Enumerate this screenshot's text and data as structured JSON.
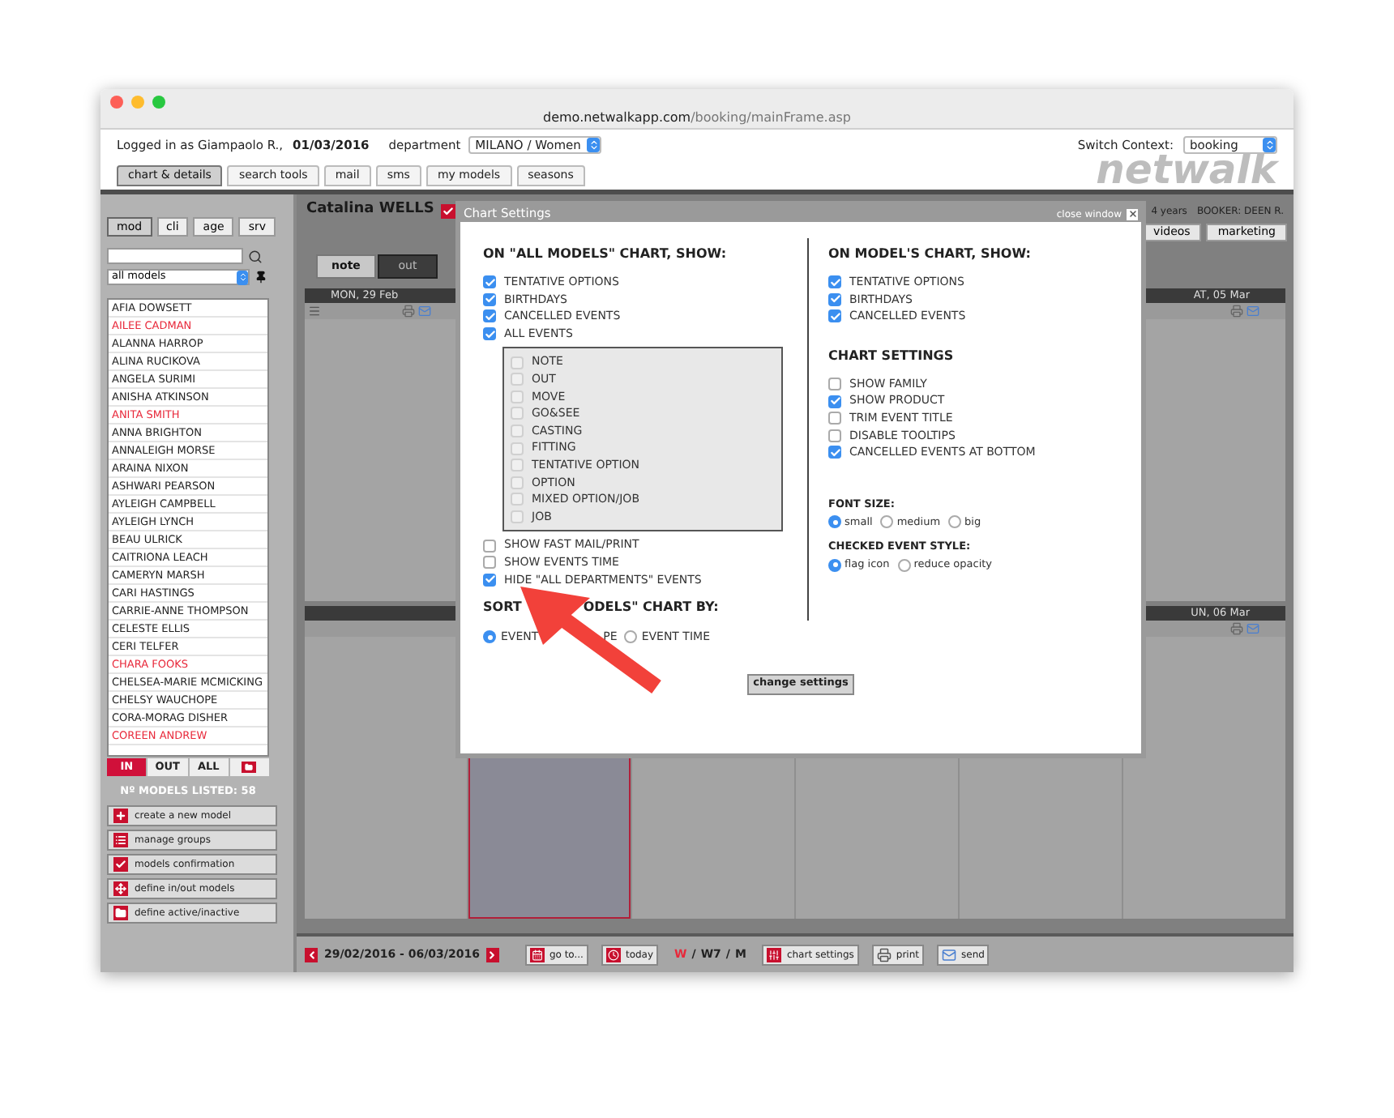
{
  "browser": {
    "url_host": "demo.netwalkapp.com",
    "url_path": "/booking/mainFrame.asp"
  },
  "header": {
    "logged_in": "Logged in as Giampaolo R.,",
    "date": "01/03/2016",
    "department_label": "department",
    "department_value": "MILANO / Women",
    "switch_context_label": "Switch Context:",
    "switch_context_value": "booking",
    "logo": "netwalk"
  },
  "nav_tabs": [
    {
      "label": "chart & details",
      "selected": true
    },
    {
      "label": "search tools",
      "selected": false
    },
    {
      "label": "mail",
      "selected": false
    },
    {
      "label": "sms",
      "selected": false
    },
    {
      "label": "my models",
      "selected": false
    },
    {
      "label": "seasons",
      "selected": false
    }
  ],
  "sidebar": {
    "tabs": [
      {
        "label": "mod",
        "selected": true
      },
      {
        "label": "cli",
        "selected": false
      },
      {
        "label": "age",
        "selected": false
      },
      {
        "label": "srv",
        "selected": false
      }
    ],
    "filter": "all models",
    "models": [
      {
        "name": "AFIA DOWSETT",
        "color": "#222222"
      },
      {
        "name": "AILEE CADMAN",
        "color": "#e8283a"
      },
      {
        "name": "ALANNA HARROP",
        "color": "#222222"
      },
      {
        "name": "ALINA RUCIKOVA",
        "color": "#222222"
      },
      {
        "name": "ANGELA SURIMI",
        "color": "#222222"
      },
      {
        "name": "ANISHA ATKINSON",
        "color": "#222222"
      },
      {
        "name": "ANITA SMITH",
        "color": "#e8283a"
      },
      {
        "name": "ANNA BRIGHTON",
        "color": "#222222"
      },
      {
        "name": "ANNALEIGH MORSE",
        "color": "#222222"
      },
      {
        "name": "ARAINA NIXON",
        "color": "#222222"
      },
      {
        "name": "ASHWARI PEARSON",
        "color": "#222222"
      },
      {
        "name": "AYLEIGH CAMPBELL",
        "color": "#222222"
      },
      {
        "name": "AYLEIGH LYNCH",
        "color": "#222222"
      },
      {
        "name": "BEAU ULRICK",
        "color": "#222222"
      },
      {
        "name": "CAITRIONA LEACH",
        "color": "#222222"
      },
      {
        "name": "CAMERYN MARSH",
        "color": "#222222"
      },
      {
        "name": "CARI HASTINGS",
        "color": "#222222"
      },
      {
        "name": "CARRIE-ANNE THOMPSON",
        "color": "#222222"
      },
      {
        "name": "CELESTE ELLIS",
        "color": "#222222"
      },
      {
        "name": "CERI TELFER",
        "color": "#222222"
      },
      {
        "name": "CHARA FOOKS",
        "color": "#e8283a"
      },
      {
        "name": "CHELSEA-MARIE MCMICKING",
        "color": "#222222"
      },
      {
        "name": "CHELSY WAUCHOPE",
        "color": "#222222"
      },
      {
        "name": "CORA-MORAG DISHER",
        "color": "#222222"
      },
      {
        "name": "COREEN ANDREW",
        "color": "#e8283a"
      }
    ],
    "toggles": [
      {
        "label": "IN",
        "selected": true
      },
      {
        "label": "OUT",
        "selected": false
      },
      {
        "label": "ALL",
        "selected": false
      },
      {
        "kind": "folder",
        "selected": false
      }
    ],
    "count": "Nº MODELS LISTED: 58",
    "actions": [
      "create a new model",
      "manage groups",
      "models confirmation",
      "define in/out models",
      "define active/inactive"
    ]
  },
  "model": {
    "name": "Catalina WELLS",
    "age": "4 years",
    "booker": "BOOKER: DEEN R.",
    "tabs": [
      "videos",
      "marketing"
    ]
  },
  "toolbar": [
    {
      "label": "note",
      "selected": false
    },
    {
      "label": "out",
      "selected": true
    }
  ],
  "calendar": {
    "week_1_first_day": "MON, 29 Feb",
    "week_1_last_day": "AT, 05 Mar",
    "week_2_last_day": "UN, 06 Mar",
    "week_2_columns": [
      {
        "today": false
      },
      {
        "today": true
      },
      {
        "today": false
      },
      {
        "today": false
      },
      {
        "today": false
      },
      {
        "today": false
      }
    ]
  },
  "bottom_bar": {
    "range": "29/02/2016 - 06/03/2016",
    "goto": "go to...",
    "today": "today",
    "views": [
      {
        "label": "W",
        "selected": true
      },
      {
        "label": "W7",
        "selected": false
      },
      {
        "label": "M",
        "selected": false
      }
    ],
    "separators": [
      "/",
      "/"
    ],
    "chart_settings": "chart settings",
    "print": "print",
    "send": "send"
  },
  "modal": {
    "title": "Chart Settings",
    "close": "close window",
    "all_models": {
      "heading": "ON \"ALL MODELS\" CHART, SHOW:",
      "options": [
        {
          "label": "TENTATIVE OPTIONS",
          "checked": true
        },
        {
          "label": "BIRTHDAYS",
          "checked": true
        },
        {
          "label": "CANCELLED EVENTS",
          "checked": true
        },
        {
          "label": "ALL EVENTS",
          "checked": true
        }
      ],
      "event_types": [
        {
          "label": "NOTE",
          "checked": false
        },
        {
          "label": "OUT",
          "checked": false
        },
        {
          "label": "MOVE",
          "checked": false
        },
        {
          "label": "GO&SEE",
          "checked": false
        },
        {
          "label": "CASTING",
          "checked": false
        },
        {
          "label": "FITTING",
          "checked": false
        },
        {
          "label": "TENTATIVE OPTION",
          "checked": false
        },
        {
          "label": "OPTION",
          "checked": false
        },
        {
          "label": "MIXED OPTION/JOB",
          "checked": false
        },
        {
          "label": "JOB",
          "checked": false
        }
      ],
      "extra_options": [
        {
          "label": "SHOW FAST MAIL/PRINT",
          "checked": false
        },
        {
          "label": "SHOW EVENTS TIME",
          "checked": false
        },
        {
          "label": "HIDE \"ALL DEPARTMENTS\" EVENTS",
          "checked": true
        }
      ],
      "sort_heading_parts": [
        "SORT",
        "ODELS\" CHART BY:"
      ],
      "sort_options": [
        {
          "label_parts": [
            "EVENT",
            "PE"
          ],
          "selected": true
        },
        {
          "label_parts": [
            "EVENT TIME"
          ],
          "selected": false
        }
      ]
    },
    "model_chart": {
      "heading": "ON MODEL'S CHART, SHOW:",
      "options": [
        {
          "label": "TENTATIVE OPTIONS",
          "checked": true
        },
        {
          "label": "BIRTHDAYS",
          "checked": true
        },
        {
          "label": "CANCELLED EVENTS",
          "checked": true
        }
      ]
    },
    "chart_settings": {
      "heading": "CHART SETTINGS",
      "options": [
        {
          "label": "SHOW FAMILY",
          "checked": false
        },
        {
          "label": "SHOW PRODUCT",
          "checked": true
        },
        {
          "label": "TRIM EVENT TITLE",
          "checked": false
        },
        {
          "label": "DISABLE TOOLTIPS",
          "checked": false
        },
        {
          "label": "CANCELLED EVENTS AT BOTTOM",
          "checked": true
        }
      ]
    },
    "font_size": {
      "label": "FONT SIZE:",
      "options": [
        {
          "label": "small",
          "selected": true
        },
        {
          "label": "medium",
          "selected": false
        },
        {
          "label": "big",
          "selected": false
        }
      ]
    },
    "event_style": {
      "label": "CHECKED EVENT STYLE:",
      "options": [
        {
          "label": "flag icon",
          "selected": true
        },
        {
          "label": "reduce opacity",
          "selected": false
        }
      ]
    },
    "submit": "change settings"
  }
}
